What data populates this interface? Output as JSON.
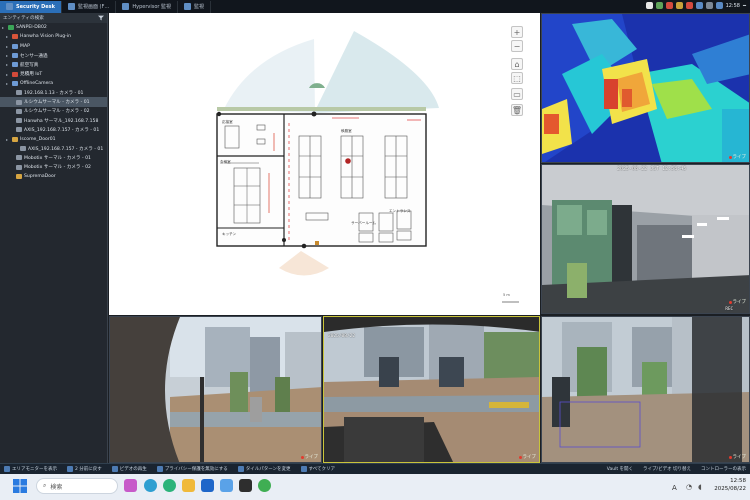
{
  "titlebar": {
    "tabs": [
      {
        "label": "Security Desk",
        "active": true
      },
      {
        "label": "監視画面 (F…",
        "active": false
      },
      {
        "label": "Hypervisor 監視",
        "active": false
      },
      {
        "label": "監視",
        "active": false
      }
    ],
    "tray_clock": "12:58",
    "win_controls": "━"
  },
  "sidebar": {
    "header": "エンティティの検索",
    "filter_icon": "filter-icon",
    "items": [
      {
        "label": "SANPEI-DB02",
        "color": "#3aa557"
      },
      {
        "label": "Hanwha Vision Plug-in",
        "color": "#d8553a"
      },
      {
        "label": "MAP",
        "color": "#6e9bd6"
      },
      {
        "label": "センサー通過",
        "color": "#6e9bd6"
      },
      {
        "label": "航空写真",
        "color": "#6e9bd6"
      },
      {
        "label": "見積用 IoT",
        "color": "#d24a3a"
      },
      {
        "label": "OfflineCamera",
        "color": "#6e9bd6"
      },
      {
        "label": "192.168.1.13 - カメラ - 01",
        "color": "#8b95a3"
      },
      {
        "label": "ルシウムサーマル - カメラ - 01",
        "color": "#8b95a3"
      },
      {
        "label": "ルシウムサーマル - カメラ - 02",
        "color": "#8b95a3"
      },
      {
        "label": "Hanwha サーマル_192.168.7.158",
        "color": "#8b95a3"
      },
      {
        "label": "AXIS_192.168.7.157 - カメラ - 01",
        "color": "#8b95a3"
      },
      {
        "label": "Iscome_Door01",
        "color": "#d6a542"
      },
      {
        "label": "AXIS_192.168.7.157 - カメラ - 01",
        "color": "#8b95a3"
      },
      {
        "label": "Mobotix サーマル - カメラ - 01",
        "color": "#8b95a3"
      },
      {
        "label": "Mobotix サーマル - カメラ - 02",
        "color": "#8b95a3"
      },
      {
        "label": "SupremaDoor",
        "color": "#d6a542"
      }
    ]
  },
  "map": {
    "room_labels": [
      "応接室",
      "会議室",
      "キッチン",
      "執務室",
      "サーバールーム",
      "エントランス"
    ],
    "scale_label": "5 m"
  },
  "cameras": {
    "thermal_live": "ライブ",
    "office_timestamp": "2025-08-22 JST 12:58:45",
    "office_live": "ライブ",
    "office_rec": "REC",
    "street1_live": "ライブ",
    "street2_timestamp": "2025/08/22",
    "street2_live": "ライブ",
    "street3_live": "ライブ"
  },
  "bottombar": {
    "items": [
      "エリアモニターを表示",
      "2 分前に戻す",
      "ビデオの再生",
      "プライバシー保護を無効にする",
      "タイルパターンを変更",
      "すべてクリア"
    ],
    "right_items": [
      "Vault を開く",
      "ライブ/ビデオ 切り替え",
      "コントローラーの表示"
    ]
  },
  "taskbar": {
    "search_placeholder": "検索",
    "time": "12:58",
    "date": "2025/08/22",
    "lang": "A"
  },
  "colors": {
    "accent": "#2b6fb8",
    "live_dot": "#e23b2e",
    "selected_row": "#4a5663"
  }
}
